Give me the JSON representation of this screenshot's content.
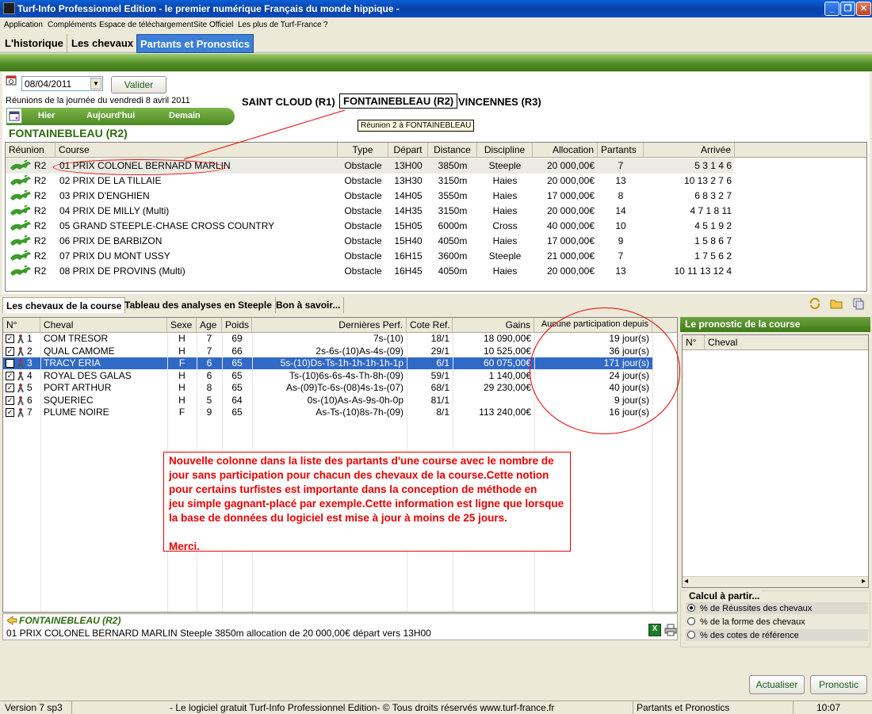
{
  "window": {
    "title": "Turf-Info Professionnel Edition - le premier numérique Français du monde hippique -"
  },
  "menu": [
    "Application",
    "Compléments",
    "Espace de téléchargement",
    "Site Officiel",
    "Les plus de Turf-France",
    "?"
  ],
  "main_tabs": [
    "L'historique",
    "Les chevaux",
    "Partants et Pronostics"
  ],
  "date": {
    "value": "08/04/2011",
    "validate_label": "Valider"
  },
  "reunions_label": "Réunions de la journée du vendredi 8 avril 2011",
  "reunions": [
    "SAINT CLOUD (R1)",
    "FONTAINEBLEAU (R2)",
    "VINCENNES (R3)"
  ],
  "reunion_tooltip": "Réunion 2 à FONTAINEBLEAU",
  "nav": {
    "hier": "Hier",
    "aujourdhui": "Aujourd'hui",
    "demain": "Demain"
  },
  "section_title": "FONTAINEBLEAU (R2)",
  "races_table": {
    "headers": [
      "Réunion",
      "Course",
      "Type",
      "Départ",
      "Distance",
      "Discipline",
      "Allocation",
      "Partants",
      "Arrivée"
    ],
    "rows": [
      {
        "reunion": "R2",
        "course": "01 PRIX COLONEL BERNARD MARLIN",
        "type": "Obstacle",
        "depart": "13H00",
        "distance": "3850m",
        "discipline": "Steeple",
        "allocation": "20 000,00€",
        "partants": "7",
        "arrivee": "5 3 1 4 6"
      },
      {
        "reunion": "R2",
        "course": "02 PRIX DE LA TILLAIE",
        "type": "Obstacle",
        "depart": "13H30",
        "distance": "3150m",
        "discipline": "Haies",
        "allocation": "20 000,00€",
        "partants": "13",
        "arrivee": "10 13 2 7 6"
      },
      {
        "reunion": "R2",
        "course": "03 PRIX D'ENGHIEN",
        "type": "Obstacle",
        "depart": "14H05",
        "distance": "3550m",
        "discipline": "Haies",
        "allocation": "17 000,00€",
        "partants": "8",
        "arrivee": "6 8 3 2 7"
      },
      {
        "reunion": "R2",
        "course": "04 PRIX DE MILLY (Multi)",
        "type": "Obstacle",
        "depart": "14H35",
        "distance": "3150m",
        "discipline": "Haies",
        "allocation": "20 000,00€",
        "partants": "14",
        "arrivee": "4 7 1 8 11"
      },
      {
        "reunion": "R2",
        "course": "05 GRAND STEEPLE-CHASE CROSS COUNTRY",
        "type": "Obstacle",
        "depart": "15H05",
        "distance": "6000m",
        "discipline": "Cross",
        "allocation": "40 000,00€",
        "partants": "10",
        "arrivee": "4 5 1 9 2"
      },
      {
        "reunion": "R2",
        "course": "06 PRIX DE BARBIZON",
        "type": "Obstacle",
        "depart": "15H40",
        "distance": "4050m",
        "discipline": "Haies",
        "allocation": "17 000,00€",
        "partants": "9",
        "arrivee": "1 5 8 6 7"
      },
      {
        "reunion": "R2",
        "course": "07 PRIX DU MONT USSY",
        "type": "Obstacle",
        "depart": "16H15",
        "distance": "3600m",
        "discipline": "Steeple",
        "allocation": "21 000,00€",
        "partants": "7",
        "arrivee": "1 7 5 6 2"
      },
      {
        "reunion": "R2",
        "course": "08 PRIX DE PROVINS (Multi)",
        "type": "Obstacle",
        "depart": "16H45",
        "distance": "4050m",
        "discipline": "Haies",
        "allocation": "20 000,00€",
        "partants": "13",
        "arrivee": "10 11 13 12 4"
      }
    ]
  },
  "sub_tabs": [
    "Les chevaux de la course",
    "Tableau des analyses en Steeple",
    "Bon à savoir..."
  ],
  "horses_table": {
    "headers": [
      "N°",
      "Cheval",
      "Sexe",
      "Age",
      "Poids",
      "Dernières Perf.",
      "Cote Ref.",
      "Gains",
      "Aucune participation depuis"
    ],
    "rows": [
      {
        "num": "1",
        "cheval": "COM TRESOR",
        "sexe": "H",
        "age": "7",
        "poids": "69",
        "perf": "7s-(10)",
        "cote": "18/1",
        "gains": "18 090,00€",
        "depuis": "19 jour(s)"
      },
      {
        "num": "2",
        "cheval": "QUAL CAMOME",
        "sexe": "H",
        "age": "7",
        "poids": "66",
        "perf": "2s-6s-(10)As-4s-(09)",
        "cote": "29/1",
        "gains": "10 525,00€",
        "depuis": "36 jour(s)"
      },
      {
        "num": "3",
        "cheval": "TRACY ERIA",
        "sexe": "F",
        "age": "6",
        "poids": "65",
        "perf": "5s-(10)Ds-Ts-1h-1h-1h-1h-1p",
        "cote": "6/1",
        "gains": "60 075,00€",
        "depuis": "171 jour(s)"
      },
      {
        "num": "4",
        "cheval": "ROYAL DES GALAS",
        "sexe": "H",
        "age": "6",
        "poids": "65",
        "perf": "Ts-(10)6s-6s-4s-Th-8h-(09)",
        "cote": "59/1",
        "gains": "1 140,00€",
        "depuis": "24 jour(s)"
      },
      {
        "num": "5",
        "cheval": "PORT ARTHUR",
        "sexe": "H",
        "age": "8",
        "poids": "65",
        "perf": "As-(09)Tc-6s-(08)4s-1s-(07)",
        "cote": "68/1",
        "gains": "29 230,00€",
        "depuis": "40 jour(s)"
      },
      {
        "num": "6",
        "cheval": "SQUERIEC",
        "sexe": "H",
        "age": "5",
        "poids": "64",
        "perf": "0s-(10)As-As-9s-0h-0p",
        "cote": "81/1",
        "gains": "",
        "depuis": "9 jour(s)"
      },
      {
        "num": "7",
        "cheval": "PLUME NOIRE",
        "sexe": "F",
        "age": "9",
        "poids": "65",
        "perf": "As-Ts-(10)8s-7h-(09)",
        "cote": "8/1",
        "gains": "113 240,00€",
        "depuis": "16 jour(s)"
      }
    ]
  },
  "annotation": {
    "lines": [
      "Nouvelle colonne dans la liste des partants d'une course avec le nombre de",
      "jour sans participation pour chacun des chevaux de la course.Cette notion",
      "pour certains turfistes est importante dans la conception de méthode en",
      "jeu simple gagnant-placé par exemple.Cette information est ligne que lorsque",
      "la base de données du logiciel est mise à jour à moins de 25 jours."
    ],
    "thanks": "Merci."
  },
  "prono": {
    "title": "Le pronostic de la course",
    "col_num": "N°",
    "col_cheval": "Cheval"
  },
  "calcul": {
    "title": "Calcul à partir...",
    "options": [
      "% de Réussites des chevaux",
      "% de la forme des chevaux",
      "% des cotes de référence"
    ]
  },
  "info": {
    "title": "FONTAINEBLEAU (R2)",
    "text": "01 PRIX COLONEL BERNARD MARLIN Steeple 3850m allocation de 20 000,00€ départ vers 13H00"
  },
  "buttons": {
    "actualiser": "Actualiser",
    "pronostic": "Pronostic"
  },
  "status": {
    "version": "Version 7 sp3",
    "copyright": "- Le logiciel gratuit Turf-Info Professionnel Edition- © Tous droits réservés www.turf-france.fr",
    "section": "Partants et Pronostics",
    "time": "10:07"
  },
  "colors": {
    "accent_green": "#4e8a24",
    "selection_blue": "#3169c6",
    "annotation_red": "#e00000"
  }
}
